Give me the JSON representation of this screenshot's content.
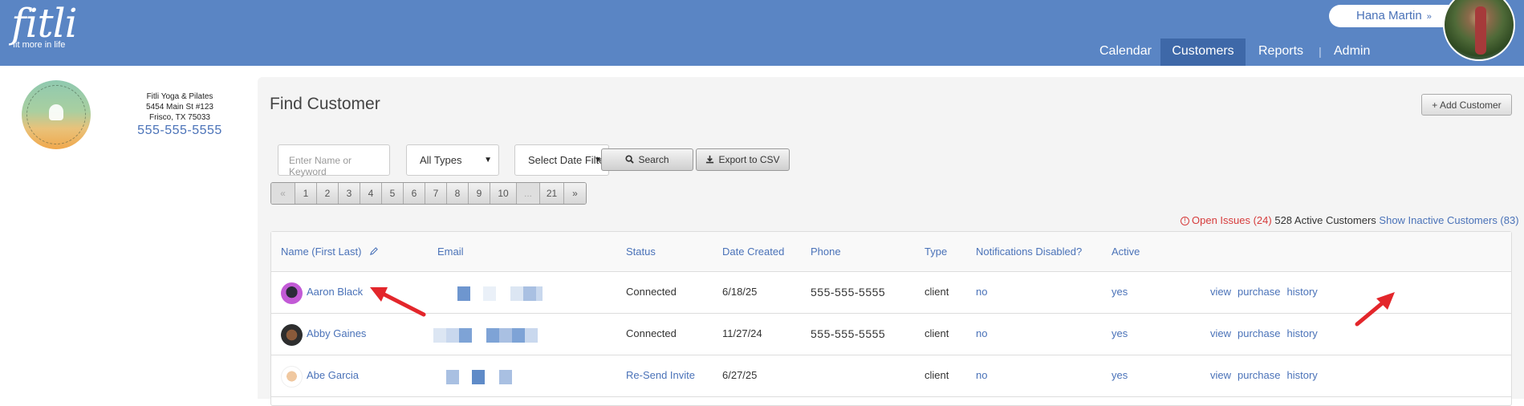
{
  "header": {
    "logo_word": "fitli",
    "logo_tagline": "fit more in life",
    "user_name": "Hana Martin",
    "user_chevron": "»",
    "nav": [
      {
        "label": "Calendar"
      },
      {
        "label": "Customers"
      },
      {
        "label": "Reports"
      },
      {
        "label": "Admin"
      }
    ],
    "nav_separator": "|"
  },
  "studio": {
    "name": "Fitli Yoga & Pilates",
    "address1": "5454 Main St #123",
    "address2": "Frisco, TX 75033",
    "phone": "555-555-5555"
  },
  "page": {
    "title": "Find Customer",
    "add_button": "+ Add Customer"
  },
  "filters": {
    "search_placeholder": "Enter Name or Keyword",
    "type_selected": "All Types",
    "date_selected": "Select Date Filter",
    "search_button": "Search",
    "export_button": "Export to CSV"
  },
  "pager": [
    "«",
    "1",
    "2",
    "3",
    "4",
    "5",
    "6",
    "7",
    "8",
    "9",
    "10",
    "...",
    "21",
    "»"
  ],
  "summary": {
    "open_issues_icon": "!",
    "open_issues": "Open Issues (24)",
    "active_customers": "528 Active Customers",
    "show_inactive": "Show Inactive Customers (83)"
  },
  "table": {
    "columns": [
      "Name (First Last)",
      "Email",
      "Status",
      "Date Created",
      "Phone",
      "Type",
      "Notifications Disabled?",
      "Active"
    ],
    "rows": [
      {
        "name": "Aaron Black",
        "status": "Connected",
        "date": "6/18/25",
        "phone": "555-555-5555",
        "type": "client",
        "notifications_disabled": "no",
        "active": "yes",
        "actions": [
          "view",
          "purchase",
          "history"
        ]
      },
      {
        "name": "Abby Gaines",
        "status": "Connected",
        "date": "11/27/24",
        "phone": "555-555-5555",
        "type": "client",
        "notifications_disabled": "no",
        "active": "yes",
        "actions": [
          "view",
          "purchase",
          "history"
        ]
      },
      {
        "name": "Abe Garcia",
        "status": "Re-Send Invite",
        "date": "6/27/25",
        "phone": "",
        "type": "client",
        "notifications_disabled": "no",
        "active": "yes",
        "actions": [
          "view",
          "purchase",
          "history"
        ]
      }
    ]
  },
  "colors": {
    "brand": "#5a85c4",
    "nav_active": "#3e68a8",
    "link": "#4a72b8",
    "alert": "#d63b3b",
    "annotation_arrow": "#e3262b"
  }
}
